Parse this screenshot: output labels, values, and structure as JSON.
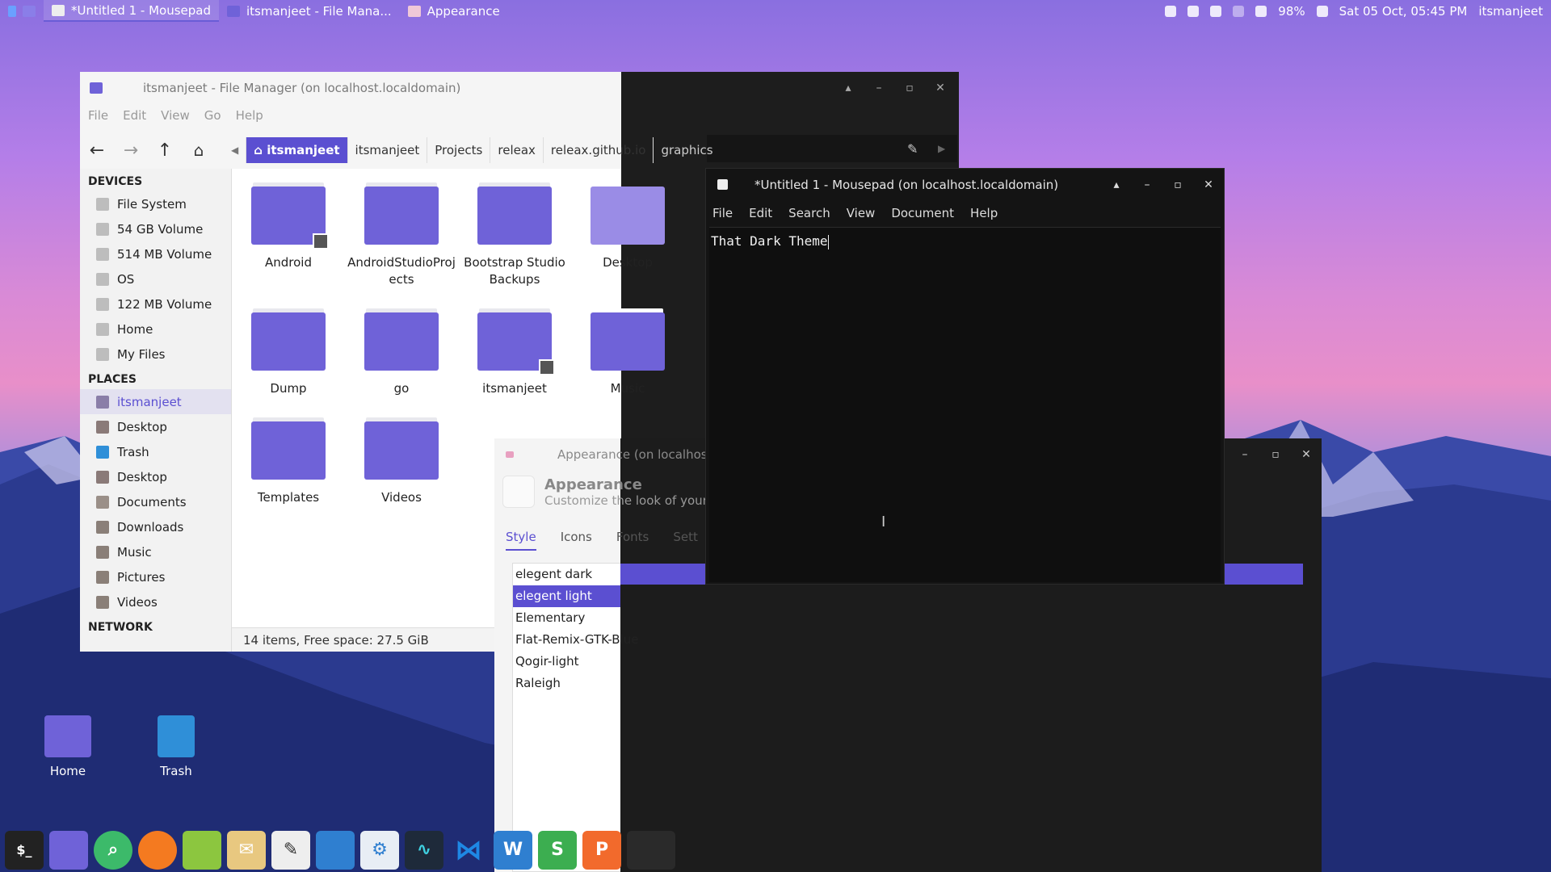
{
  "top_panel": {
    "tasks": [
      {
        "label": "*Untitled 1 - Mousepad",
        "active": true
      },
      {
        "label": "itsmanjeet - File Mana...",
        "active": false
      },
      {
        "label": "Appearance",
        "active": false
      }
    ],
    "battery": "98%",
    "clock": "Sat 05 Oct, 05:45 PM",
    "user": "itsmanjeet"
  },
  "file_manager": {
    "title": "itsmanjeet - File Manager (on localhost.localdomain)",
    "menu": [
      "File",
      "Edit",
      "View",
      "Go",
      "Help"
    ],
    "breadcrumbs": [
      "itsmanjeet",
      "itsmanjeet",
      "Projects",
      "releax",
      "releax.github.io",
      "graphics"
    ],
    "sidebar": {
      "devices_header": "DEVICES",
      "devices": [
        "File System",
        "54 GB Volume",
        "514 MB Volume",
        "OS",
        "122 MB Volume",
        "Home",
        "My Files"
      ],
      "places_header": "PLACES",
      "places": [
        "itsmanjeet",
        "Desktop",
        "Trash",
        "Desktop",
        "Documents",
        "Downloads",
        "Music",
        "Pictures",
        "Videos"
      ],
      "network_header": "NETWORK"
    },
    "files": [
      {
        "name": "Android",
        "link": true
      },
      {
        "name": "AndroidStudioProj ects",
        "link": false
      },
      {
        "name": "Bootstrap Studio Backups",
        "link": false
      },
      {
        "name": "Desktop",
        "link": false
      },
      {
        "name": "Dump",
        "link": false
      },
      {
        "name": "go",
        "link": false
      },
      {
        "name": "itsmanjeet",
        "link": true
      },
      {
        "name": "Music",
        "link": false
      },
      {
        "name": "Templates",
        "link": false
      },
      {
        "name": "Videos",
        "link": false
      }
    ],
    "status": "14 items, Free space: 27.5 GiB"
  },
  "mousepad": {
    "title": "*Untitled 1 - Mousepad (on localhost.localdomain)",
    "menu": [
      "File",
      "Edit",
      "Search",
      "View",
      "Document",
      "Help"
    ],
    "text": "That Dark Theme"
  },
  "appearance": {
    "title": "Appearance (on localhost.l",
    "heading": "Appearance",
    "subheading": "Customize the look of your d",
    "tabs": [
      "Style",
      "Icons",
      "Fonts",
      "Sett"
    ],
    "themes": [
      "elegent dark",
      "elegent light",
      "Elementary",
      "Flat-Remix-GTK-Blue",
      "Qogir-light",
      "Raleigh"
    ],
    "selected_theme": "elegent light"
  },
  "desktop_icons": [
    "Home",
    "Trash"
  ],
  "colors": {
    "accent": "#5b4fd1",
    "folder": "#6f62d8"
  }
}
